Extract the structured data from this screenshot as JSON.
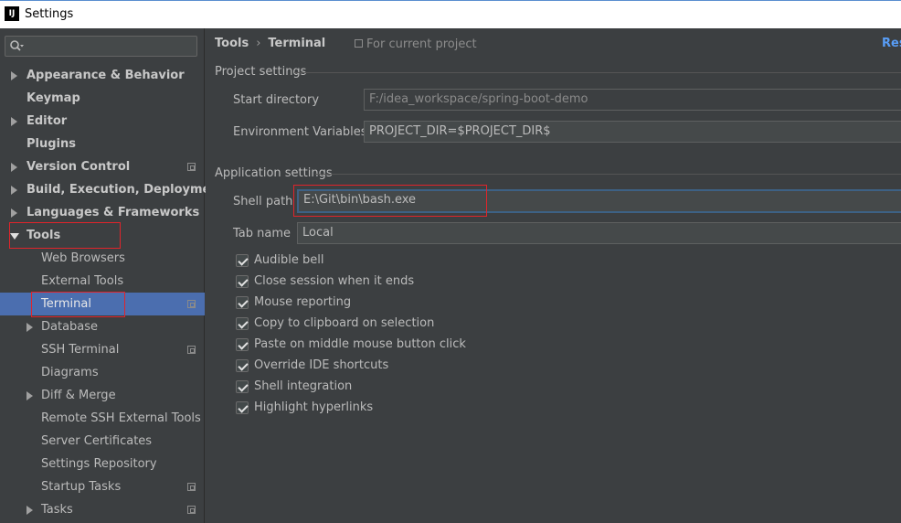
{
  "window": {
    "title": "Settings",
    "icon_text": "IJ"
  },
  "sidebar": {
    "search_placeholder": "",
    "items": [
      {
        "label": "Appearance & Behavior"
      },
      {
        "label": "Keymap"
      },
      {
        "label": "Editor"
      },
      {
        "label": "Plugins"
      },
      {
        "label": "Version Control"
      },
      {
        "label": "Build, Execution, Deployment"
      },
      {
        "label": "Languages & Frameworks"
      },
      {
        "label": "Tools"
      },
      {
        "label": "Web Browsers"
      },
      {
        "label": "External Tools"
      },
      {
        "label": "Terminal"
      },
      {
        "label": "Database"
      },
      {
        "label": "SSH Terminal"
      },
      {
        "label": "Diagrams"
      },
      {
        "label": "Diff & Merge"
      },
      {
        "label": "Remote SSH External Tools"
      },
      {
        "label": "Server Certificates"
      },
      {
        "label": "Settings Repository"
      },
      {
        "label": "Startup Tasks"
      },
      {
        "label": "Tasks"
      }
    ]
  },
  "main": {
    "breadcrumb": {
      "parent": "Tools",
      "separator": "›",
      "current": "Terminal"
    },
    "scope": "For current project",
    "reset": "Res",
    "project_settings": {
      "title": "Project settings",
      "start_directory": {
        "label": "Start directory",
        "value": "F:/idea_workspace/spring-boot-demo"
      },
      "env_vars": {
        "label": "Environment Variables",
        "value": "PROJECT_DIR=$PROJECT_DIR$"
      }
    },
    "app_settings": {
      "title": "Application settings",
      "shell_path": {
        "label": "Shell path",
        "value": "E:\\Git\\bin\\bash.exe"
      },
      "tab_name": {
        "label": "Tab name",
        "value": "Local"
      },
      "checkboxes": [
        {
          "label": "Audible bell",
          "checked": true
        },
        {
          "label": "Close session when it ends",
          "checked": true
        },
        {
          "label": "Mouse reporting",
          "checked": true
        },
        {
          "label": "Copy to clipboard on selection",
          "checked": true
        },
        {
          "label": "Paste on middle mouse button click",
          "checked": true
        },
        {
          "label": "Override IDE shortcuts",
          "checked": true
        },
        {
          "label": "Shell integration",
          "checked": true
        },
        {
          "label": "Highlight hyperlinks",
          "checked": true
        }
      ]
    }
  },
  "colors": {
    "selection": "#4b6eaf",
    "highlight_box": "#e0242b",
    "link": "#589df6"
  }
}
